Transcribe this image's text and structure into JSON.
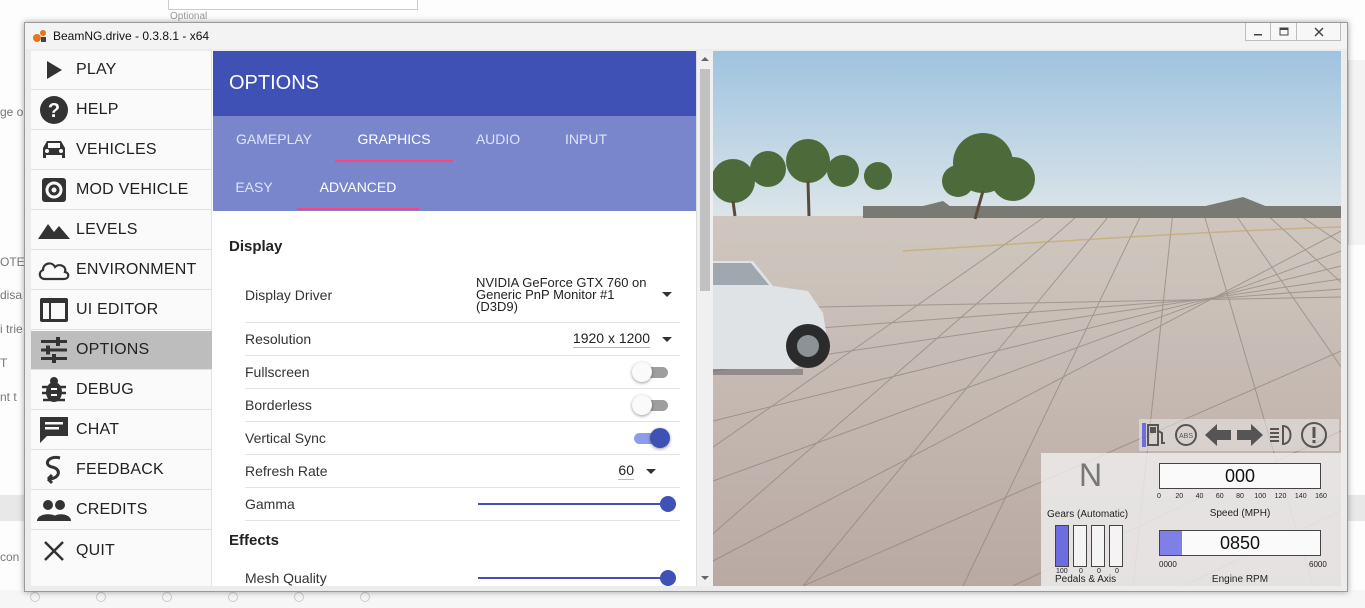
{
  "background": {
    "optional_text": "Optional",
    "side_fragments": [
      "ge or",
      "OTE",
      "disa",
      "i trie",
      "T",
      "nt t",
      "con"
    ]
  },
  "window": {
    "title": "BeamNG.drive - 0.3.8.1 - x64",
    "app_icon": "beamng-logo-icon",
    "controls": [
      "minimize-icon",
      "restore-icon",
      "close-icon"
    ]
  },
  "menu": {
    "items": [
      {
        "label": "PLAY",
        "icon": "play-icon"
      },
      {
        "label": "HELP",
        "icon": "help-icon"
      },
      {
        "label": "VEHICLES",
        "icon": "car-icon"
      },
      {
        "label": "MOD VEHICLE",
        "icon": "gear-icon"
      },
      {
        "label": "LEVELS",
        "icon": "mountain-icon"
      },
      {
        "label": "ENVIRONMENT",
        "icon": "cloud-icon"
      },
      {
        "label": "UI EDITOR",
        "icon": "ui-editor-icon"
      },
      {
        "label": "OPTIONS",
        "icon": "sliders-icon",
        "active": true
      },
      {
        "label": "DEBUG",
        "icon": "bug-icon"
      },
      {
        "label": "CHAT",
        "icon": "chat-icon"
      },
      {
        "label": "FEEDBACK",
        "icon": "feedback-icon"
      },
      {
        "label": "CREDITS",
        "icon": "people-icon"
      },
      {
        "label": "QUIT",
        "icon": "close-x-icon"
      }
    ]
  },
  "options": {
    "title": "OPTIONS",
    "tabs": [
      "GAMEPLAY",
      "GRAPHICS",
      "AUDIO",
      "INPUT"
    ],
    "active_tab": "GRAPHICS",
    "subtabs": [
      "EASY",
      "ADVANCED"
    ],
    "active_subtab": "ADVANCED",
    "display_section": "Display",
    "display_driver": {
      "label": "Display Driver",
      "value": "NVIDIA GeForce GTX 760 on Generic PnP Monitor #1 (D3D9)"
    },
    "resolution": {
      "label": "Resolution",
      "value": "1920 x 1200"
    },
    "fullscreen": {
      "label": "Fullscreen",
      "on": false
    },
    "borderless": {
      "label": "Borderless",
      "on": false
    },
    "vsync": {
      "label": "Vertical Sync",
      "on": true
    },
    "refresh_rate": {
      "label": "Refresh Rate",
      "value": "60"
    },
    "gamma": {
      "label": "Gamma",
      "level": 1.0
    },
    "effects_section": "Effects",
    "mesh_quality": {
      "label": "Mesh Quality",
      "level": 1.0
    }
  },
  "hud": {
    "gear": "N",
    "gear_label": "Gears (Automatic)",
    "pedals": [
      {
        "value": "100",
        "fill": 1.0
      },
      {
        "value": "0",
        "fill": 0.0
      },
      {
        "value": "0",
        "fill": 0.0
      },
      {
        "value": "0",
        "fill": 0.0
      }
    ],
    "pedals_label": "Pedals & Axis",
    "speed": "000",
    "speed_ticks": [
      "0",
      "20",
      "40",
      "60",
      "80",
      "100",
      "120",
      "140",
      "160"
    ],
    "speed_label": "Speed (MPH)",
    "rpm": "0850",
    "rpm_fill": 0.14,
    "rpm_min": "0000",
    "rpm_max": "6000",
    "rpm_label": "Engine RPM",
    "warning_icons": [
      "fuel-icon",
      "abs-icon",
      "left-arrow-icon",
      "right-arrow-icon",
      "headlight-icon",
      "warning-icon"
    ]
  },
  "colors": {
    "header": "#3f51b5",
    "tabs_bg": "#7986cb",
    "tab_indicator": "#ff4081",
    "toggle_on": "#3f51b5"
  }
}
